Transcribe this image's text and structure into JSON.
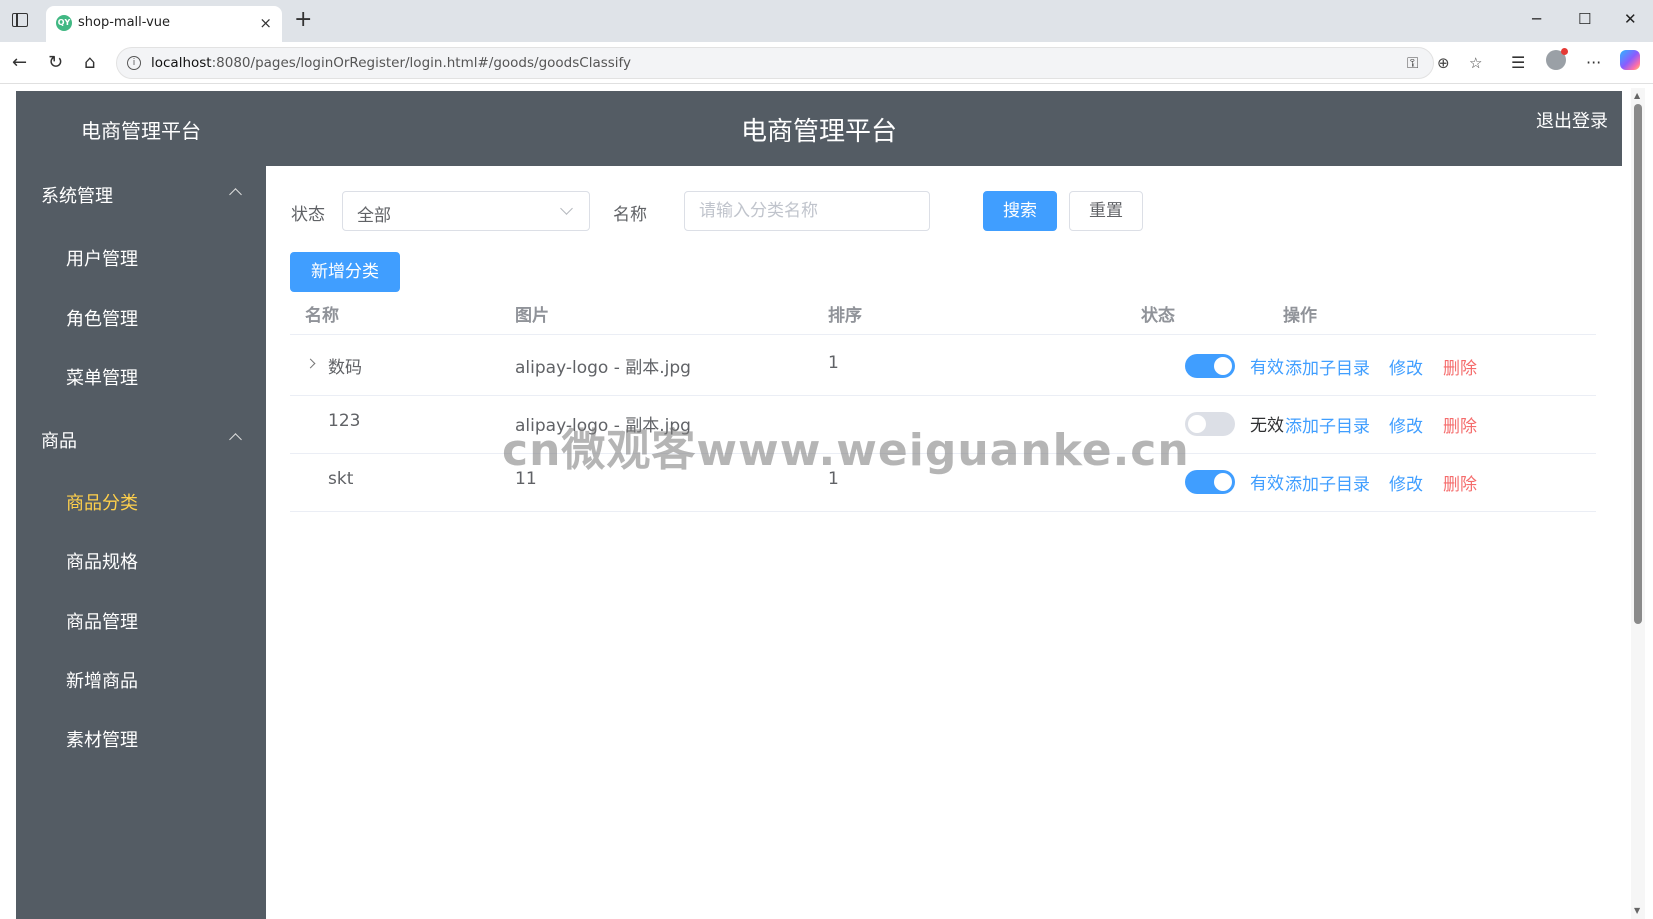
{
  "browser": {
    "tab_title": "shop-mall-vue",
    "favicon_text": "QY",
    "url_host": "localhost",
    "url_path": ":8080/pages/loginOrRegister/login.html#/goods/goodsClassify",
    "icons": {
      "tab_strip": "tab-strip-icon",
      "new_tab": "+",
      "close_tab": "×",
      "minimize": "─",
      "maximize": "☐",
      "close": "✕",
      "back": "←",
      "reload": "↻",
      "home": "⌂",
      "key": "⚿",
      "zoom": "⊕",
      "favorite": "☆",
      "favorites": "☰",
      "more": "···"
    }
  },
  "header": {
    "brand": "电商管理平台",
    "title": "电商管理平台",
    "logout": "退出登录",
    "bg_color": "#545c64"
  },
  "sidebar": {
    "groups": [
      {
        "label": "系统管理",
        "items": [
          {
            "label": "用户管理"
          },
          {
            "label": "角色管理"
          },
          {
            "label": "菜单管理"
          }
        ]
      },
      {
        "label": "商品",
        "items": [
          {
            "label": "商品分类",
            "active": true
          },
          {
            "label": "商品规格"
          },
          {
            "label": "商品管理"
          },
          {
            "label": "新增商品"
          },
          {
            "label": "素材管理"
          }
        ]
      }
    ],
    "active_color": "#ffd04b"
  },
  "filter": {
    "status_label": "状态",
    "status_value": "全部",
    "name_label": "名称",
    "name_placeholder": "请输入分类名称",
    "search_button": "搜索",
    "reset_button": "重置"
  },
  "add_button": "新增分类",
  "table": {
    "columns": [
      "名称",
      "图片",
      "排序",
      "状态",
      "操作"
    ],
    "rows": [
      {
        "name": "数码",
        "image": "alipay-logo - 副本.jpg",
        "sort": "1",
        "status_on": true,
        "status_text": "有效",
        "expandable": true
      },
      {
        "name": "123",
        "image": "alipay-logo - 副本.jpg",
        "sort": "",
        "status_on": false,
        "status_text": "无效",
        "expandable": false
      },
      {
        "name": "skt",
        "image": "11",
        "sort": "1",
        "status_on": true,
        "status_text": "有效",
        "expandable": false
      }
    ],
    "actions": {
      "add_child": "添加子目录",
      "edit": "修改",
      "delete": "删除"
    }
  },
  "watermark": "cn微观客www.weiguanke.cn",
  "colors": {
    "primary": "#409eff",
    "danger": "#f56c6c"
  }
}
